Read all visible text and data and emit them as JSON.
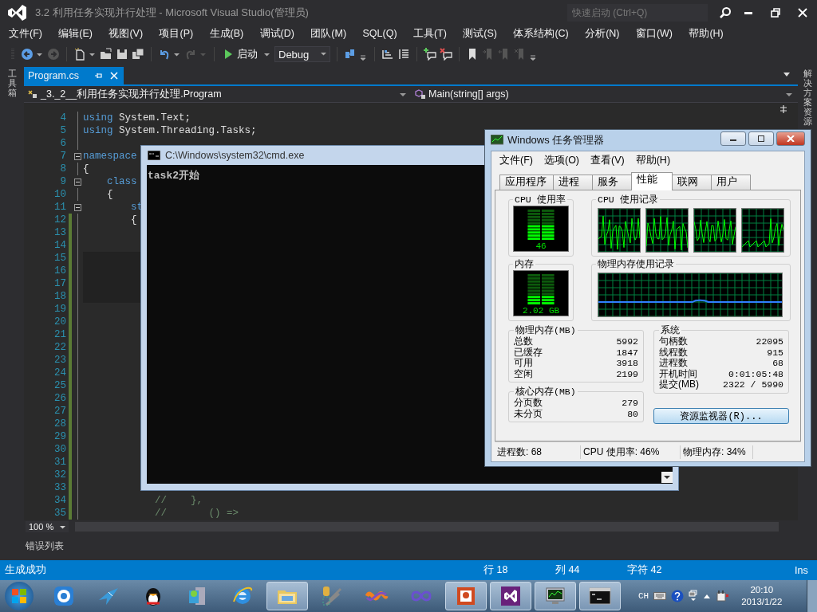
{
  "window": {
    "title": "3.2  利用任务实现并行处理 - Microsoft Visual Studio(管理员)"
  },
  "quick_launch": {
    "placeholder": "快速启动 (Ctrl+Q)"
  },
  "menu": [
    "文件(F)",
    "编辑(E)",
    "视图(V)",
    "项目(P)",
    "生成(B)",
    "调试(D)",
    "团队(M)",
    "SQL(Q)",
    "工具(T)",
    "测试(S)",
    "体系结构(C)",
    "分析(N)",
    "窗口(W)",
    "帮助(H)"
  ],
  "toolbar": [
    {
      "kind": "icon",
      "disabled": false
    },
    {
      "kind": "caret",
      "disabled": false
    },
    {
      "kind": "icon",
      "disabled": true
    },
    {
      "kind": "separator"
    },
    {
      "kind": "icon",
      "disabled": false
    },
    {
      "kind": "caret",
      "disabled": false
    },
    {
      "kind": "icon",
      "disabled": false
    },
    {
      "kind": "icon",
      "disabled": false
    },
    {
      "kind": "icon",
      "disabled": false
    },
    {
      "kind": "separator"
    },
    {
      "kind": "icon",
      "disabled": false
    },
    {
      "kind": "caret",
      "disabled": false
    },
    {
      "kind": "icon",
      "disabled": true
    },
    {
      "kind": "caret",
      "disabled": true
    },
    {
      "kind": "separator"
    },
    {
      "kind": "start",
      "label": "启动"
    },
    {
      "kind": "dropdown",
      "value": "Debug"
    },
    {
      "kind": "separator"
    },
    {
      "kind": "icon",
      "disabled": false
    },
    {
      "kind": "overflow"
    },
    {
      "kind": "separator"
    },
    {
      "kind": "icon",
      "disabled": false
    },
    {
      "kind": "icon",
      "disabled": false
    },
    {
      "kind": "separator"
    },
    {
      "kind": "icon",
      "disabled": false
    },
    {
      "kind": "icon",
      "disabled": false
    },
    {
      "kind": "separator"
    },
    {
      "kind": "icon",
      "disabled": false
    },
    {
      "kind": "icon",
      "disabled": true
    },
    {
      "kind": "icon",
      "disabled": true
    },
    {
      "kind": "icon",
      "disabled": true
    },
    {
      "kind": "overflow"
    }
  ],
  "left_panel": "工具箱",
  "right_panel": "解决方案资源",
  "tabs": [
    {
      "label": "Program.cs",
      "selected": true
    }
  ],
  "navigation": {
    "type": "_3._2__利用任务实现并行处理.Program",
    "member": "Main(string[] args)"
  },
  "editor": {
    "lines": [
      {
        "number": "4",
        "changed": false,
        "collapsible": false,
        "highlighted": false,
        "tokens": [
          {
            "kind": "keyword",
            "text": "using"
          },
          {
            "kind": "plain",
            "text": " System.Text;"
          }
        ]
      },
      {
        "number": "5",
        "changed": false,
        "collapsible": false,
        "highlighted": false,
        "tokens": [
          {
            "kind": "keyword",
            "text": "using"
          },
          {
            "kind": "plain",
            "text": " System.Threading.Tasks;"
          }
        ]
      },
      {
        "number": "6",
        "changed": false,
        "collapsible": false,
        "highlighted": false
      },
      {
        "number": "7",
        "changed": false,
        "collapsible": true,
        "highlighted": false,
        "tokens": [
          {
            "kind": "keyword",
            "text": "namespace"
          }
        ]
      },
      {
        "number": "8",
        "changed": false,
        "collapsible": false,
        "highlighted": false,
        "tokens": [
          {
            "kind": "plain",
            "text": "{"
          }
        ]
      },
      {
        "number": "9",
        "changed": false,
        "collapsible": true,
        "highlighted": false,
        "tokens": [
          {
            "kind": "keyword",
            "text": "    class"
          }
        ]
      },
      {
        "number": "10",
        "changed": false,
        "collapsible": false,
        "highlighted": false,
        "tokens": [
          {
            "kind": "plain",
            "text": "    {"
          }
        ]
      },
      {
        "number": "11",
        "changed": false,
        "collapsible": true,
        "highlighted": false,
        "tokens": [
          {
            "kind": "keyword",
            "text": "        st"
          }
        ]
      },
      {
        "number": "12",
        "changed": true,
        "collapsible": false,
        "highlighted": false,
        "tokens": [
          {
            "kind": "plain",
            "text": "        {"
          }
        ]
      },
      {
        "number": "13",
        "changed": true,
        "collapsible": false,
        "highlighted": false
      },
      {
        "number": "14",
        "changed": true,
        "collapsible": false,
        "highlighted": false
      },
      {
        "number": "15",
        "changed": true,
        "collapsible": false,
        "highlighted": true
      },
      {
        "number": "16",
        "changed": true,
        "collapsible": false,
        "highlighted": true
      },
      {
        "number": "17",
        "changed": true,
        "collapsible": false,
        "highlighted": true
      },
      {
        "number": "18",
        "changed": true,
        "collapsible": false,
        "highlighted": true
      },
      {
        "number": "19",
        "changed": true,
        "collapsible": false,
        "highlighted": false
      },
      {
        "number": "20",
        "changed": true,
        "collapsible": false,
        "highlighted": false
      },
      {
        "number": "21",
        "changed": true,
        "collapsible": false,
        "highlighted": false
      },
      {
        "number": "22",
        "changed": true,
        "collapsible": false,
        "highlighted": false
      },
      {
        "number": "23",
        "changed": true,
        "collapsible": false,
        "highlighted": false
      },
      {
        "number": "24",
        "changed": true,
        "collapsible": false,
        "highlighted": false
      },
      {
        "number": "25",
        "changed": true,
        "collapsible": false,
        "highlighted": false
      },
      {
        "number": "26",
        "changed": true,
        "collapsible": false,
        "highlighted": false
      },
      {
        "number": "27",
        "changed": true,
        "collapsible": false,
        "highlighted": false
      },
      {
        "number": "28",
        "changed": true,
        "collapsible": false,
        "highlighted": false
      },
      {
        "number": "29",
        "changed": true,
        "collapsible": false,
        "highlighted": false
      },
      {
        "number": "30",
        "changed": true,
        "collapsible": false,
        "highlighted": false
      },
      {
        "number": "31",
        "changed": true,
        "collapsible": false,
        "highlighted": false
      },
      {
        "number": "32",
        "changed": true,
        "collapsible": false,
        "highlighted": false
      },
      {
        "number": "33",
        "changed": true,
        "collapsible": false,
        "highlighted": false
      },
      {
        "number": "34",
        "changed": true,
        "collapsible": false,
        "highlighted": false,
        "tokens": [
          {
            "kind": "comment",
            "text": "            //    },"
          }
        ]
      },
      {
        "number": "35",
        "changed": true,
        "collapsible": false,
        "highlighted": false,
        "tokens": [
          {
            "kind": "comment",
            "text": "            //       () =>"
          }
        ]
      }
    ]
  },
  "zoom": "100 %",
  "error_list": "错误列表",
  "status_bar": {
    "message": "生成成功",
    "line": "行 18",
    "column": "列 44",
    "character": "字符 42",
    "mode": "Ins"
  },
  "console": {
    "title": "C:\\Windows\\system32\\cmd.exe",
    "output": "task2开始"
  },
  "task_manager": {
    "title": "Windows 任务管理器",
    "menu": [
      "文件(F)",
      "选项(O)",
      "查看(V)",
      "帮助(H)"
    ],
    "tabs": [
      {
        "label": "应用程序",
        "selected": false
      },
      {
        "label": "进程",
        "selected": false
      },
      {
        "label": "服务",
        "selected": false
      },
      {
        "label": "性能",
        "selected": true
      },
      {
        "label": "联网",
        "selected": false
      },
      {
        "label": "用户",
        "selected": false
      }
    ],
    "cpu_usage": {
      "label": "CPU 使用率",
      "level": 0.46,
      "reading": "46"
    },
    "cpu_history": {
      "label": "CPU 使用记录"
    },
    "memory": {
      "label": "内存",
      "level": 0.34,
      "reading": "2.02 GB"
    },
    "memory_history": {
      "label": "物理内存使用记录"
    },
    "physical_memory": {
      "title": "物理内存(MB)",
      "rows": [
        {
          "label": "总数",
          "value": "5992"
        },
        {
          "label": "已缓存",
          "value": "1847"
        },
        {
          "label": "可用",
          "value": "3918"
        },
        {
          "label": "空闲",
          "value": "2199"
        }
      ]
    },
    "kernel_memory": {
      "title": "核心内存(MB)",
      "rows": [
        {
          "label": "分页数",
          "value": "279"
        },
        {
          "label": "未分页",
          "value": "80"
        }
      ]
    },
    "system": {
      "title": "系统",
      "rows": [
        {
          "label": "句柄数",
          "value": "22095"
        },
        {
          "label": "线程数",
          "value": "915"
        },
        {
          "label": "进程数",
          "value": "68"
        },
        {
          "label": "开机时间",
          "value": "0:01:05:48"
        },
        {
          "label": "提交(MB)",
          "value": "2322 / 5990"
        }
      ]
    },
    "button": "资源监视器(R)...",
    "status_bar": [
      "进程数: 68",
      "CPU 使用率: 46%",
      "物理内存: 34%"
    ]
  },
  "taskbar": {
    "buttons": [
      {
        "open": false
      },
      {
        "open": false
      },
      {
        "open": false
      },
      {
        "open": false
      },
      {
        "open": false
      },
      {
        "open": true
      },
      {
        "open": false
      },
      {
        "open": false
      },
      {
        "open": false
      },
      {
        "open": true
      },
      {
        "open": true
      },
      {
        "open": true
      },
      {
        "open": true
      }
    ],
    "language": "CH",
    "time": "20:10",
    "date": "2013/1/22"
  }
}
